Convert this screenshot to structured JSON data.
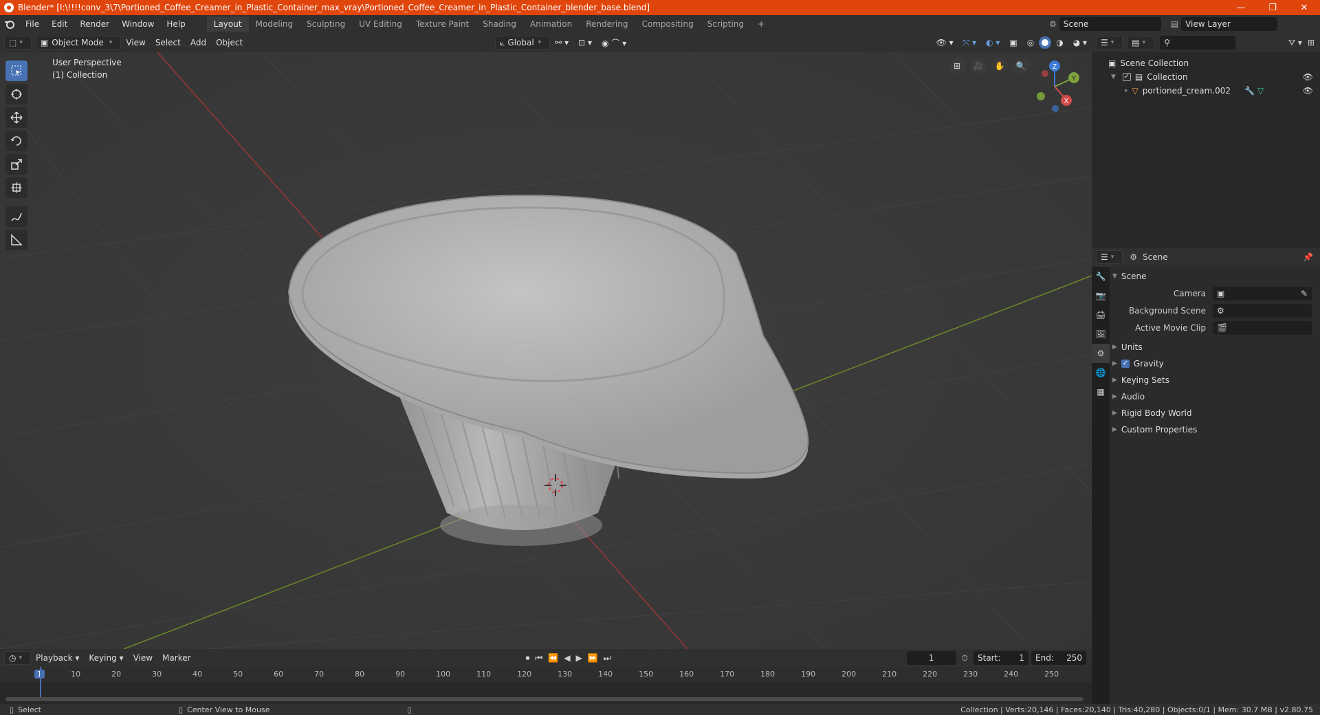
{
  "window": {
    "title": "Blender* [I:\\!!!!conv_3\\7\\Portioned_Coffee_Creamer_in_Plastic_Container_max_vray\\Portioned_Coffee_Creamer_in_Plastic_Container_blender_base.blend]",
    "minimize": "—",
    "maximize": "❐",
    "close": "✕"
  },
  "menu": {
    "items": [
      "File",
      "Edit",
      "Render",
      "Window",
      "Help"
    ]
  },
  "workspaces": {
    "tabs": [
      "Layout",
      "Modeling",
      "Sculpting",
      "UV Editing",
      "Texture Paint",
      "Shading",
      "Animation",
      "Rendering",
      "Compositing",
      "Scripting"
    ],
    "active": "Layout",
    "add": "+"
  },
  "scene_field": "Scene",
  "viewlayer_field": "View Layer",
  "viewport_header": {
    "mode": "Object Mode",
    "menus": [
      "View",
      "Select",
      "Add",
      "Object"
    ],
    "transform": "Global"
  },
  "viewport": {
    "perspective": "User Perspective",
    "collection": "(1) Collection",
    "axes": {
      "x": "X",
      "y": "Y",
      "z": "Z"
    }
  },
  "outliner": {
    "search_placeholder": "",
    "root": "Scene Collection",
    "collection": "Collection",
    "object": "portioned_cream.002"
  },
  "properties": {
    "header": "Scene",
    "section": "Scene",
    "camera_label": "Camera",
    "background_label": "Background Scene",
    "clip_label": "Active Movie Clip",
    "panels": [
      "Units",
      "Gravity",
      "Keying Sets",
      "Audio",
      "Rigid Body World",
      "Custom Properties"
    ],
    "gravity_checked": true
  },
  "timeline": {
    "menus": [
      "Playback",
      "Keying",
      "View",
      "Marker"
    ],
    "current_frame": "1",
    "start_label": "Start:",
    "start": "1",
    "end_label": "End:",
    "end": "250",
    "ticks": [
      "1",
      "10",
      "20",
      "30",
      "40",
      "50",
      "60",
      "70",
      "80",
      "90",
      "100",
      "110",
      "120",
      "130",
      "140",
      "150",
      "160",
      "170",
      "180",
      "190",
      "200",
      "210",
      "220",
      "230",
      "240",
      "250"
    ]
  },
  "status": {
    "left": "Select",
    "middle": "Center View to Mouse",
    "right": "Collection | Verts:20,146 | Faces:20,140 | Tris:40,280 | Objects:0/1 | Mem: 30.7 MB | v2.80.75"
  },
  "colors": {
    "accent": "#4772b3",
    "title": "#e0450b",
    "x_axis": "#a33b3b",
    "y_axis": "#6b8a2a"
  }
}
